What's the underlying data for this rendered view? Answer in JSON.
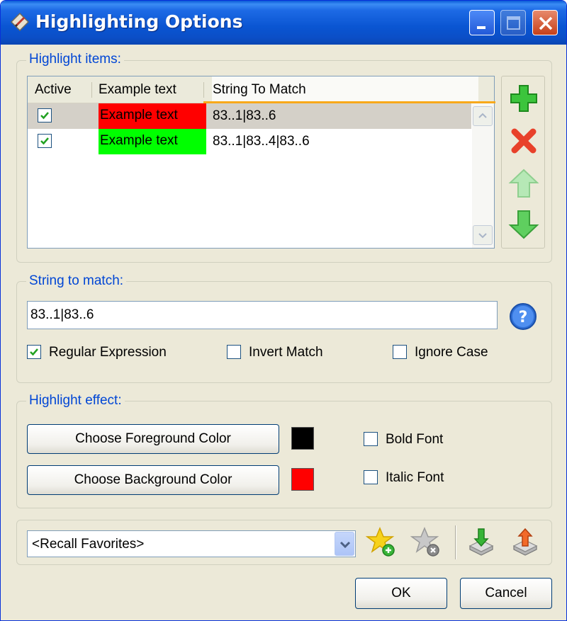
{
  "window": {
    "title": "Highlighting Options",
    "app_icon": "pencil-diamond-icon"
  },
  "titlebar_buttons": {
    "minimize_icon": "minimize-icon",
    "maximize_icon": "maximize-icon",
    "close_icon": "close-icon"
  },
  "highlight_items": {
    "legend": "Highlight items:",
    "columns": [
      "Active",
      "Example text",
      "String To Match"
    ],
    "rows": [
      {
        "active": true,
        "example_text": "Example text",
        "example_bg": "#ff0000",
        "example_fg": "#000000",
        "string": "83..1|83..6",
        "selected": true
      },
      {
        "active": true,
        "example_text": "Example text",
        "example_bg": "#00ff00",
        "example_fg": "#000000",
        "string": "83..1|83..4|83..6",
        "selected": false
      }
    ],
    "side_buttons": [
      "add-icon",
      "delete-icon",
      "move-up-icon",
      "move-down-icon"
    ]
  },
  "string_to_match": {
    "legend": "String to match:",
    "value": "83..1|83..6",
    "help_icon": "help-icon",
    "regular_expression": {
      "label": "Regular Expression",
      "mnemonic": "x",
      "checked": true
    },
    "invert_match": {
      "label": "Invert Match",
      "mnemonic": "M",
      "checked": false
    },
    "ignore_case": {
      "label": "Ignore Case",
      "mnemonic": "I",
      "checked": false
    }
  },
  "highlight_effect": {
    "legend": "Highlight effect:",
    "foreground_button": "Choose Foreground Color",
    "background_button": "Choose Background Color",
    "foreground_color": "#000000",
    "background_color": "#ff0000",
    "bold_font": {
      "label": "Bold Font",
      "checked": false
    },
    "italic_font": {
      "label": "Italic Font",
      "checked": false
    }
  },
  "favorites": {
    "combo_value": "<Recall Favorites>",
    "icons": [
      "add-favorite-icon",
      "remove-favorite-icon",
      "import-icon",
      "export-icon"
    ]
  },
  "dialog_buttons": {
    "ok": "OK",
    "cancel": "Cancel"
  },
  "colors": {
    "title_blue": "#0a55d2",
    "legend_blue": "#0046d5",
    "dialog_bg": "#ece9d8",
    "header_accent": "#f8a91a"
  }
}
